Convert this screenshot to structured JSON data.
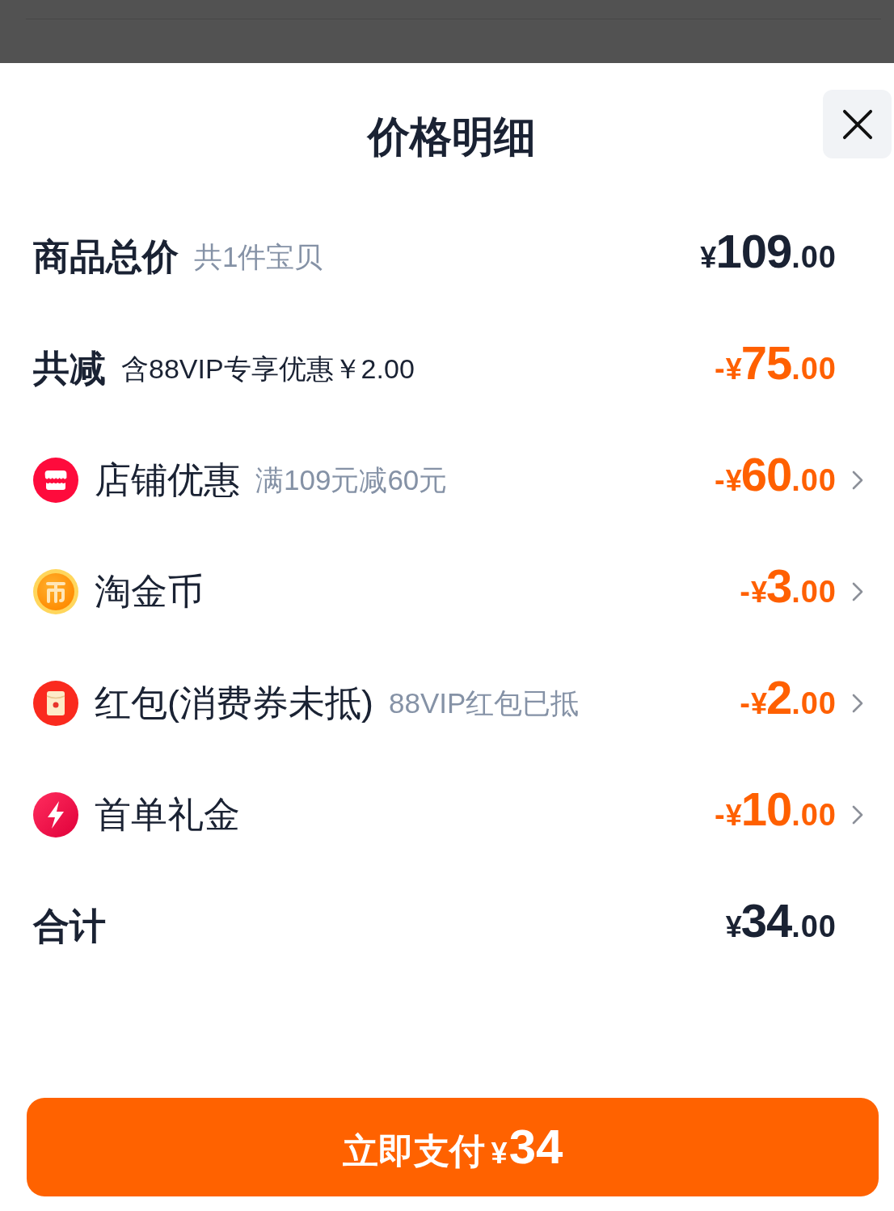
{
  "sheet": {
    "title": "价格明细"
  },
  "rows": [
    {
      "kind": "subtotal",
      "label": "商品总价",
      "note": "共1件宝贝",
      "amount": {
        "currency": "¥",
        "whole": "109",
        "fraction": ".00"
      },
      "discount": false,
      "expandable": false
    },
    {
      "kind": "savings",
      "label": "共减",
      "note": "含88VIP专享优惠￥2.00",
      "amount": {
        "sign": "-",
        "currency": "¥",
        "whole": "75",
        "fraction": ".00"
      },
      "discount": true,
      "expandable": false
    },
    {
      "kind": "store",
      "label": "店铺优惠",
      "note": "满109元减60元",
      "amount": {
        "sign": "-",
        "currency": "¥",
        "whole": "60",
        "fraction": ".00"
      },
      "discount": true,
      "expandable": true
    },
    {
      "kind": "coin",
      "label": "淘金币",
      "amount": {
        "sign": "-",
        "currency": "¥",
        "whole": "3",
        "fraction": ".00"
      },
      "discount": true,
      "expandable": true
    },
    {
      "kind": "packet",
      "label": "红包(消费券未抵)",
      "note": "88VIP红包已抵",
      "amount": {
        "sign": "-",
        "currency": "¥",
        "whole": "2",
        "fraction": ".00"
      },
      "discount": true,
      "expandable": true
    },
    {
      "kind": "bolt",
      "label": "首单礼金",
      "amount": {
        "sign": "-",
        "currency": "¥",
        "whole": "10",
        "fraction": ".00"
      },
      "discount": true,
      "expandable": true
    },
    {
      "kind": "total",
      "label": "合计",
      "amount": {
        "currency": "¥",
        "whole": "34",
        "fraction": ".00"
      },
      "discount": false,
      "expandable": false
    }
  ],
  "pay_button": {
    "label": "立即支付",
    "currency": "¥",
    "amount": "34"
  }
}
